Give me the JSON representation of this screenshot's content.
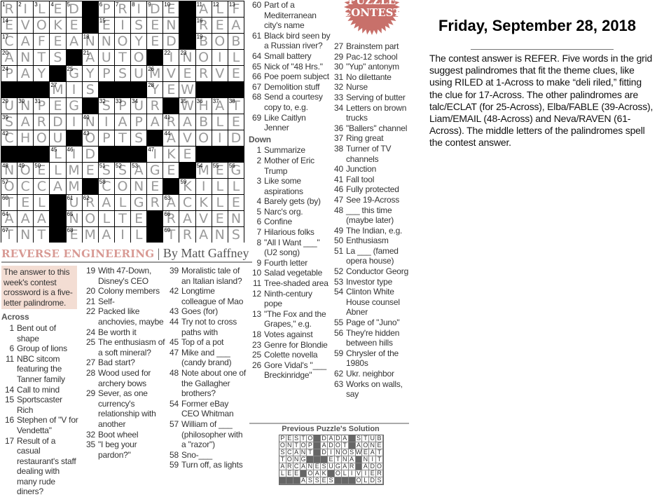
{
  "puzzle": {
    "grid_rows": [
      "RILED#PRIDE#ALF",
      "EVOKE#EISEN#REA",
      "CAFEANNOYED#BOB",
      "ANTS#AUTO#INOIL",
      "PAY#GYPSUMVERVE",
      "###MIS###YEW###",
      "UNPEG#SPUR#WHAT",
      "SARDINIAPARABLE",
      "CHOU#OPTS#AVOID",
      "###LID###IKE###",
      "NOELMESSAGE#MEG",
      "OCCAM#CONE#KILL",
      "TEL#URALGRACKLE",
      "AAA#NOLTE#RAVEN",
      "TNT#EMAIL#TRANS"
    ],
    "title": "REVERSE ENGINEERING",
    "byline": "| By Matt Gaffney",
    "intro": "The answer to this week's contest crossword is a five-letter palindrome.",
    "badge": {
      "line1": "PUZZLE",
      "line2": "CONTEST",
      "color": "#c8706a"
    }
  },
  "clues": {
    "across_header": "Across",
    "down_header": "Down",
    "col1": [
      {
        "n": "1",
        "t": "Bent out of shape"
      },
      {
        "n": "6",
        "t": "Group of lions"
      },
      {
        "n": "11",
        "t": "NBC sitcom featuring the Tanner family"
      },
      {
        "n": "14",
        "t": "Call to mind"
      },
      {
        "n": "15",
        "t": "Sportscaster Rich"
      },
      {
        "n": "16",
        "t": "Stephen of \"V for Vendetta\""
      },
      {
        "n": "17",
        "t": "Result of a casual restaurant's staff dealing with many rude diners?"
      }
    ],
    "col2": [
      {
        "n": "19",
        "t": "With 47-Down, Disney's CEO"
      },
      {
        "n": "20",
        "t": "Colony members"
      },
      {
        "n": "21",
        "t": "Self-"
      },
      {
        "n": "22",
        "t": "Packed like anchovies, maybe"
      },
      {
        "n": "24",
        "t": "Be worth it"
      },
      {
        "n": "25",
        "t": "The enthusiasm of a soft mineral?"
      },
      {
        "n": "27",
        "t": "Bad start?"
      },
      {
        "n": "28",
        "t": "Wood used for archery bows"
      },
      {
        "n": "29",
        "t": "Sever, as one currency's relationship with another"
      },
      {
        "n": "32",
        "t": "Boot wheel"
      },
      {
        "n": "35",
        "t": "\"I beg your pardon?\""
      }
    ],
    "col3": [
      {
        "n": "39",
        "t": "Moralistic tale of an Italian island?"
      },
      {
        "n": "42",
        "t": "Longtime colleague of Mao"
      },
      {
        "n": "43",
        "t": "Goes (for)"
      },
      {
        "n": "44",
        "t": "Try not to cross paths with"
      },
      {
        "n": "45",
        "t": "Top of a pot"
      },
      {
        "n": "47",
        "t": "Mike and ___ (candy brand)"
      },
      {
        "n": "48",
        "t": "Note about one of the Gallagher brothers?"
      },
      {
        "n": "54",
        "t": "Former eBay CEO Whitman"
      },
      {
        "n": "57",
        "t": "William of ___ (philosopher with a \"razor\")"
      },
      {
        "n": "58",
        "t": "Sno-___"
      },
      {
        "n": "59",
        "t": "Turn off, as lights"
      }
    ],
    "col4_across": [
      {
        "n": "60",
        "t": "Part of a Mediterranean city's name"
      },
      {
        "n": "61",
        "t": "Black bird seen by a Russian river?"
      },
      {
        "n": "64",
        "t": "Small battery"
      },
      {
        "n": "65",
        "t": "Nick of \"48 Hrs.\""
      },
      {
        "n": "66",
        "t": "Poe poem subject"
      },
      {
        "n": "67",
        "t": "Demolition stuff"
      },
      {
        "n": "68",
        "t": "Send a courtesy copy to, e.g."
      },
      {
        "n": "69",
        "t": "Like Caitlyn Jenner"
      }
    ],
    "col4_down": [
      {
        "n": "1",
        "t": "Summarize"
      },
      {
        "n": "2",
        "t": "Mother of Eric Trump"
      },
      {
        "n": "3",
        "t": "Like some aspirations"
      },
      {
        "n": "4",
        "t": "Barely gets (by)"
      },
      {
        "n": "5",
        "t": "Narc's org."
      },
      {
        "n": "6",
        "t": "Confine"
      },
      {
        "n": "7",
        "t": "Hilarious folks"
      },
      {
        "n": "8",
        "t": "\"All I Want ___\" (U2 song)"
      },
      {
        "n": "9",
        "t": "Fourth letter"
      },
      {
        "n": "10",
        "t": "Salad vegetable"
      },
      {
        "n": "11",
        "t": "Tree-shaded area"
      },
      {
        "n": "12",
        "t": "Ninth-century pope"
      },
      {
        "n": "13",
        "t": "\"The Fox and the Grapes,\" e.g."
      },
      {
        "n": "18",
        "t": "Votes against"
      },
      {
        "n": "23",
        "t": "Genre for Blondie"
      },
      {
        "n": "25",
        "t": "Colette novella"
      },
      {
        "n": "26",
        "t": "Gore Vidal's \"___ Breckinridge\""
      }
    ],
    "col5": [
      {
        "n": "27",
        "t": "Brainstem part"
      },
      {
        "n": "29",
        "t": "Pac-12 school"
      },
      {
        "n": "30",
        "t": "\"Yup\" antonym"
      },
      {
        "n": "31",
        "t": "No dilettante"
      },
      {
        "n": "32",
        "t": "Nurse"
      },
      {
        "n": "33",
        "t": "Serving of butter"
      },
      {
        "n": "34",
        "t": "Letters on brown trucks"
      },
      {
        "n": "36",
        "t": "\"Ballers\" channel"
      },
      {
        "n": "37",
        "t": "Ring great"
      },
      {
        "n": "38",
        "t": "Turner of TV channels"
      },
      {
        "n": "40",
        "t": "Junction"
      },
      {
        "n": "41",
        "t": "Fall tool"
      },
      {
        "n": "46",
        "t": "Fully protected"
      },
      {
        "n": "47",
        "t": "See 19-Across"
      },
      {
        "n": "48",
        "t": "___ this time (maybe later)"
      },
      {
        "n": "49",
        "t": "The Indian, e.g."
      },
      {
        "n": "50",
        "t": "Enthusiasm"
      },
      {
        "n": "51",
        "t": "La ___ (famed opera house)"
      },
      {
        "n": "52",
        "t": "Conductor Georg"
      },
      {
        "n": "53",
        "t": "Investor type"
      },
      {
        "n": "54",
        "t": "Clinton White House counsel Abner"
      },
      {
        "n": "55",
        "t": "Page of \"Juno\""
      },
      {
        "n": "56",
        "t": "They're hidden between hills"
      },
      {
        "n": "59",
        "t": "Chrysler of the 1980s"
      },
      {
        "n": "62",
        "t": "Ukr. neighbor"
      },
      {
        "n": "63",
        "t": "Works on walls, say"
      }
    ]
  },
  "solution_note": {
    "date": "Friday, September 28, 2018",
    "text": "The contest answer is REFER. Five words in the grid suggest palindromes that fit the theme clues, like using RILED at 1-Across to make “deli riled,” fitting the clue for 17-Across. The other palindromes are talc/ECLAT (for 25-Across), Elba/FABLE (39-Across), Liam/EMAIL (48-Across) and Neva/RAVEN (61-Across). The middle letters of the palindromes spell the contest answer."
  },
  "previous": {
    "title": "Previous Puzzle's Solution",
    "rows": [
      "PESTO#DADA#STUB",
      "ONTOP#ADOT#AONE",
      "SCANT#DINOSWEAT",
      "TONG###ETNA#NIT",
      "ARCANESUGAR#ADO",
      "LEE#OAK#OLIVIER",
      "###ASSES###OLDS"
    ]
  }
}
